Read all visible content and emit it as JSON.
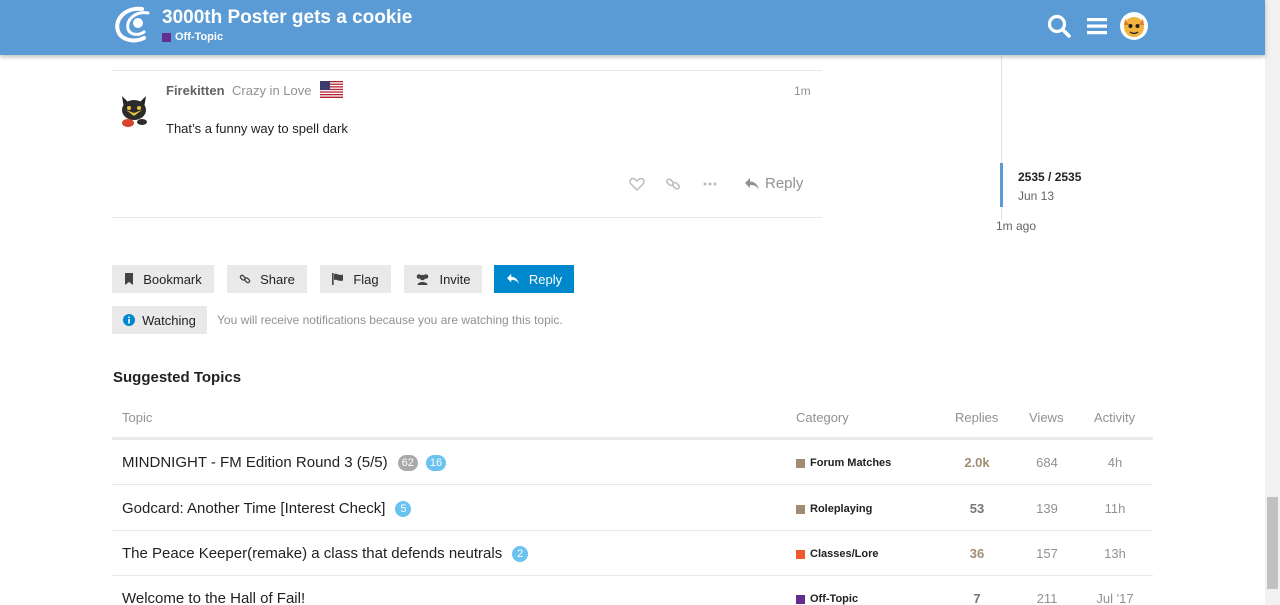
{
  "header": {
    "title": "3000th Poster gets a cookie",
    "category": "Off-Topic",
    "category_color": "#652d90"
  },
  "post": {
    "username": "Firekitten",
    "user_title": "Crazy in Love",
    "time": "1m",
    "body": "That’s a funny way to spell dark",
    "reply_label": "Reply"
  },
  "timeline": {
    "count": "2535 / 2535",
    "date": "Jun 13",
    "ago": "1m ago"
  },
  "footer_buttons": {
    "bookmark": "Bookmark",
    "share": "Share",
    "flag": "Flag",
    "invite": "Invite",
    "reply": "Reply"
  },
  "notifications": {
    "level": "Watching",
    "description": "You will receive notifications because you are watching this topic."
  },
  "suggested": {
    "title": "Suggested Topics",
    "columns": {
      "topic": "Topic",
      "category": "Category",
      "replies": "Replies",
      "views": "Views",
      "activity": "Activity"
    },
    "rows": [
      {
        "title": "MINDNIGHT - FM Edition Round 3 (5/5)",
        "badge_unread": "62",
        "badge_new": "16",
        "category": "Forum Matches",
        "category_color": "#a18c73",
        "replies": "2.0k",
        "views": "684",
        "activity": "4h"
      },
      {
        "title": "Godcard: Another Time [Interest Check]",
        "badge_new": "5",
        "category": "Roleplaying",
        "category_color": "#a18c73",
        "replies": "53",
        "views": "139",
        "activity": "11h"
      },
      {
        "title": "The Peace Keeper(remake) a class that defends neutrals",
        "badge_new": "2",
        "category": "Classes/Lore",
        "category_color": "#f1592a",
        "replies": "36",
        "views": "157",
        "activity": "13h"
      },
      {
        "title": "Welcome to the Hall of Fail!",
        "category": "Off-Topic",
        "category_color": "#652d90",
        "replies": "7",
        "views": "211",
        "activity": "Jul '17"
      }
    ]
  }
}
